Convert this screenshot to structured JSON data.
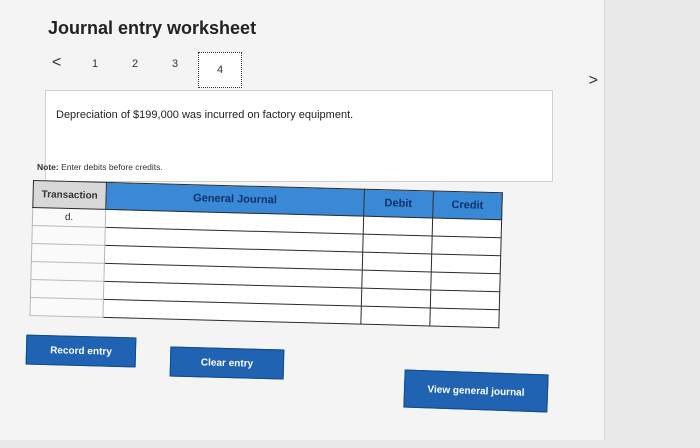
{
  "worksheet": {
    "title": "Journal entry worksheet",
    "nav": {
      "prev": "<",
      "next": ">",
      "pages": [
        "1",
        "2",
        "3",
        "4"
      ],
      "active_page": "4"
    },
    "description": "Depreciation of $199,000 was incurred on factory equipment.",
    "note_label": "Note:",
    "note_text": "Enter debits before credits."
  },
  "table": {
    "headers": {
      "transaction": "Transaction",
      "general_journal": "General Journal",
      "debit": "Debit",
      "credit": "Credit"
    },
    "rows": [
      {
        "transaction": "d.",
        "account": "",
        "debit": "",
        "credit": ""
      },
      {
        "transaction": "",
        "account": "",
        "debit": "",
        "credit": ""
      },
      {
        "transaction": "",
        "account": "",
        "debit": "",
        "credit": ""
      },
      {
        "transaction": "",
        "account": "",
        "debit": "",
        "credit": ""
      },
      {
        "transaction": "",
        "account": "",
        "debit": "",
        "credit": ""
      },
      {
        "transaction": "",
        "account": "",
        "debit": "",
        "credit": ""
      }
    ]
  },
  "buttons": {
    "record": "Record entry",
    "clear": "Clear entry",
    "view": "View general journal"
  }
}
